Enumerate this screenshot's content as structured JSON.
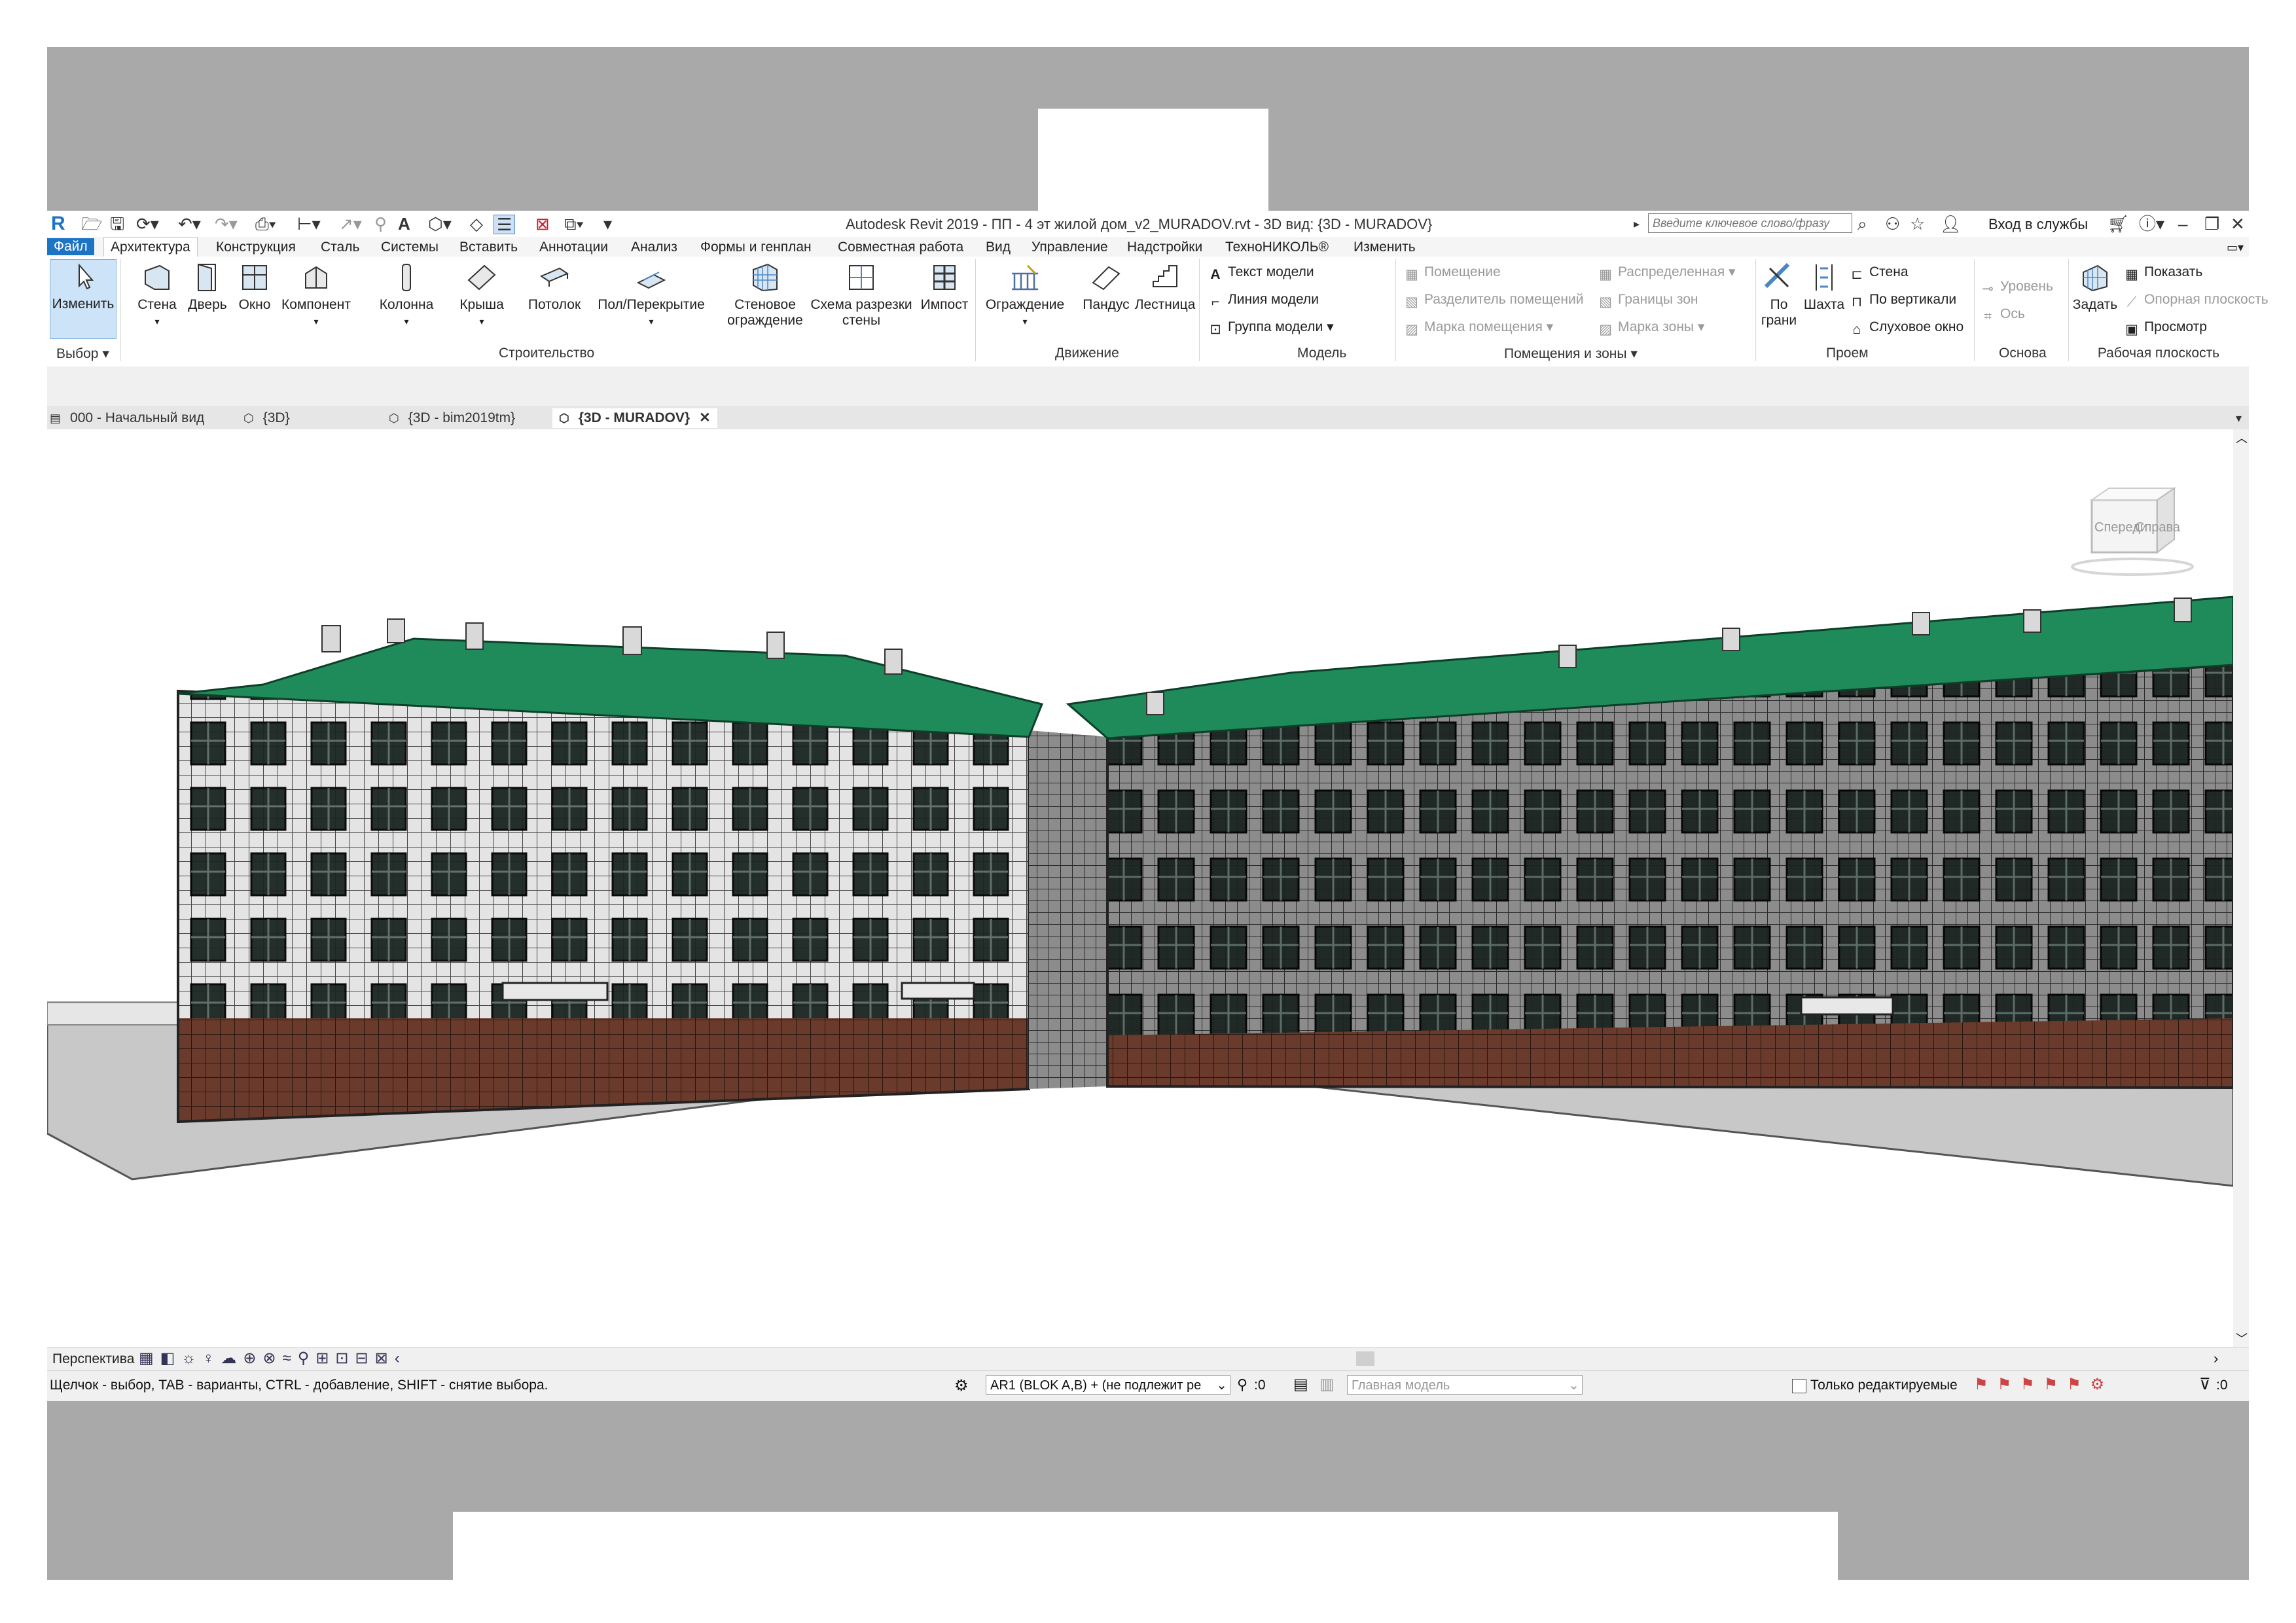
{
  "app": {
    "title": "Autodesk Revit 2019 - ПП - 4 эт жилой дом_v2_MURADOV.rvt - 3D вид: {3D - MURADOV}",
    "search_placeholder": "Введите ключевое слово/фразу",
    "sign_in": "Вход в службы"
  },
  "ribbon_tabs": [
    "Файл",
    "Архитектура",
    "Конструкция",
    "Сталь",
    "Системы",
    "Вставить",
    "Аннотации",
    "Анализ",
    "Формы и генплан",
    "Совместная работа",
    "Вид",
    "Управление",
    "Надстройки",
    "ТехноНИКОЛЬ®",
    "Изменить"
  ],
  "ribbon": {
    "select": {
      "modify": "Изменить",
      "panel": "Выбор"
    },
    "build": {
      "wall": "Стена",
      "door": "Дверь",
      "window": "Окно",
      "component": "Компонент",
      "column": "Колонна",
      "roof": "Крыша",
      "ceiling": "Потолок",
      "floor": "Пол/Перекрытие",
      "curtain_system_1": "Стеновое",
      "curtain_system_2": "ограждение",
      "curtain_grid_1": "Схема разрезки",
      "curtain_grid_2": "стены",
      "mullion": "Импост",
      "panel": "Строительство"
    },
    "circulation": {
      "railing": "Ограждение",
      "ramp": "Пандус",
      "stair": "Лестница",
      "panel": "Движение"
    },
    "model": {
      "text": "Текст модели",
      "line": "Линия модели",
      "group": "Группа модели",
      "panel": "Модель"
    },
    "room": {
      "room": "Помещение",
      "separator": "Разделитель помещений",
      "tag": "Марка помещения",
      "area": "Распределенная",
      "boundary": "Границы зон",
      "area_tag": "Марка зоны",
      "panel": "Помещения и зоны"
    },
    "opening": {
      "by_face_1": "По",
      "by_face_2": "грани",
      "shaft": "Шахта",
      "wall": "Стена",
      "vertical": "По вертикали",
      "dormer": "Слуховое окно",
      "panel": "Проем"
    },
    "datum": {
      "level": "Уровень",
      "grid": "Ось",
      "panel": "Основа"
    },
    "workplane": {
      "set": "Задать",
      "show": "Показать",
      "ref_plane": "Опорная плоскость",
      "viewer": "Просмотр",
      "panel": "Рабочая плоскость"
    }
  },
  "view_tabs": [
    "000 - Начальный вид",
    "{3D}",
    "{3D - bim2019tm}",
    "{3D - MURADOV}"
  ],
  "viewcube": {
    "front": "Спереди",
    "right": "Справа"
  },
  "view_control": {
    "perspective": "Перспектива"
  },
  "status": {
    "hint": "Щелчок - выбор, TAB - варианты, CTRL - добавление, SHIFT - снятие выбора.",
    "workset": "AR1 (BLOK A,B) + (не подлежит ре",
    "count": ":0",
    "design_option": "Главная модель",
    "editable_only": "Только редактируемые",
    "filter_count": ":0"
  },
  "colors": {
    "roof": "#1f8a5a",
    "plinth": "#6a3b2c",
    "facade_light": "#e4e4e4",
    "facade_dark": "#8c8c8c",
    "accent": "#1e74c4"
  }
}
